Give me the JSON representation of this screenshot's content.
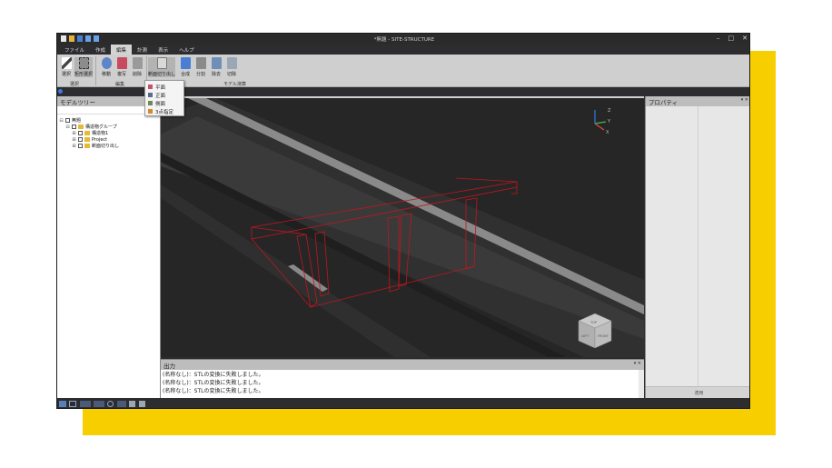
{
  "app": {
    "title": "*無題 - SITE-STRUCTURE",
    "window_controls": [
      "–",
      "□",
      "✕"
    ]
  },
  "menu": [
    "ファイル",
    "作成",
    "編集",
    "計測",
    "表示",
    "ヘルプ"
  ],
  "menu_active_index": 2,
  "ribbon": {
    "groups": [
      {
        "label": "選択",
        "buttons": [
          "選択",
          "矩形選択"
        ]
      },
      {
        "label": "編集",
        "buttons": [
          "移動",
          "複写",
          "削除"
        ]
      },
      {
        "label": "モデル演算",
        "buttons": [
          "断面切り出し",
          "合成",
          "分割",
          "除去",
          "切除"
        ]
      }
    ]
  },
  "dropdown": {
    "items": [
      {
        "label": "平面",
        "icon": "plan-view-icon",
        "color": "#c8506a"
      },
      {
        "label": "正面",
        "icon": "front-view-icon",
        "color": "#5a6e8c"
      },
      {
        "label": "側面",
        "icon": "side-view-icon",
        "color": "#6a8c5a"
      },
      {
        "label": "3点指定",
        "icon": "three-point-icon",
        "color": "#d88a2a"
      }
    ]
  },
  "model_tree": {
    "title": "モデルツリー",
    "nodes": [
      {
        "label": "無題",
        "level": 0
      },
      {
        "label": "構造物グループ",
        "level": 1
      },
      {
        "label": "構造物1",
        "level": 2
      },
      {
        "label": "Project",
        "level": 2
      },
      {
        "label": "断面切り出し",
        "level": 2
      }
    ]
  },
  "properties": {
    "title": "プロパティ",
    "apply_label": "適用"
  },
  "output": {
    "title": "出力",
    "lines": [
      "(名称なし)：STLの変換に失敗しました。",
      "(名称なし)：STLの変換に失敗しました。",
      "(名称なし)：STLの変換に失敗しました。"
    ]
  },
  "viewport": {
    "axis_labels": [
      "Z",
      "Y",
      "X"
    ],
    "view_cube": {
      "top": "TOP",
      "left": "LEFT",
      "front": "FRONT"
    },
    "colors": {
      "section_outline": "#c0161e",
      "background": "#252525"
    }
  },
  "colors": {
    "accent_yellow": "#f7cf00",
    "ribbon_bg": "#cfcfcf",
    "dark_chrome": "#2d2d30"
  }
}
